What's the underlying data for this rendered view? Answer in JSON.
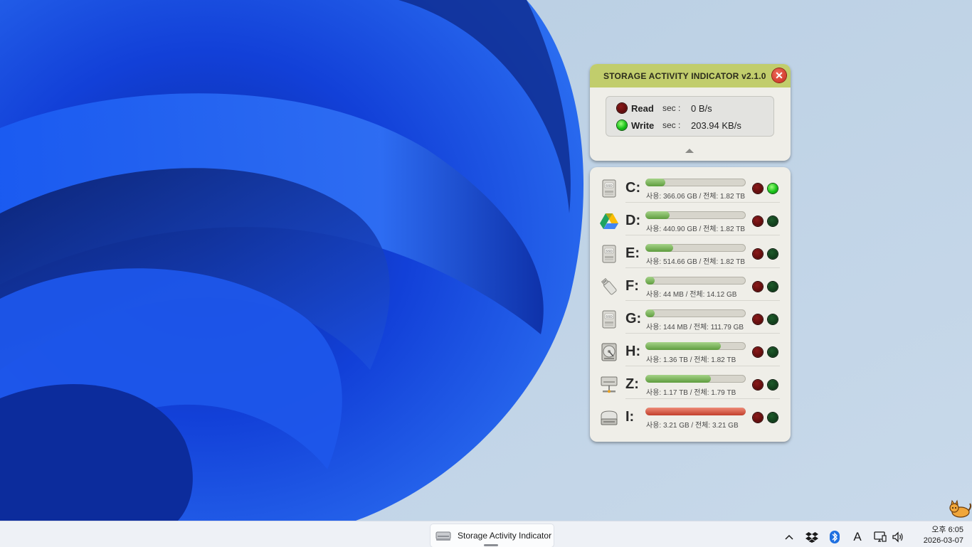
{
  "widget": {
    "title": "STORAGE ACTIVITY INDICATOR  v2.1.0",
    "close_label": "✕",
    "read_label": "Read",
    "write_label": "Write",
    "sec_label": "sec :",
    "read_value": "0 B/s",
    "write_value": "203.94 KB/s",
    "read_led_active": false,
    "write_led_active": true
  },
  "drives": [
    {
      "letter": "C:",
      "icon": "ssd-icon",
      "usage": 0.2,
      "info": "사용: 366.06 GB / 전체: 1.82 TB",
      "read_active": false,
      "write_active": true,
      "full": false
    },
    {
      "letter": "D:",
      "icon": "google-drive-icon",
      "usage": 0.24,
      "info": "사용: 440.90 GB / 전체: 1.82 TB",
      "read_active": false,
      "write_active": false,
      "full": false
    },
    {
      "letter": "E:",
      "icon": "ssd-icon",
      "usage": 0.28,
      "info": "사용: 514.66 GB / 전체: 1.82 TB",
      "read_active": false,
      "write_active": false,
      "full": false
    },
    {
      "letter": "F:",
      "icon": "usb-drive-icon",
      "usage": 0.02,
      "info": "사용: 44 MB / 전체: 14.12 GB",
      "read_active": false,
      "write_active": false,
      "full": false
    },
    {
      "letter": "G:",
      "icon": "ssd-icon",
      "usage": 0.02,
      "info": "사용: 144 MB / 전체: 111.79 GB",
      "read_active": false,
      "write_active": false,
      "full": false
    },
    {
      "letter": "H:",
      "icon": "hard-disk-icon",
      "usage": 0.75,
      "info": "사용: 1.36 TB / 전체: 1.82 TB",
      "read_active": false,
      "write_active": false,
      "full": false
    },
    {
      "letter": "Z:",
      "icon": "network-drive-icon",
      "usage": 0.65,
      "info": "사용: 1.17 TB / 전체: 1.79 TB",
      "read_active": false,
      "write_active": false,
      "full": false
    },
    {
      "letter": "I:",
      "icon": "optical-drive-icon",
      "usage": 1.0,
      "info": "사용: 3.21 GB / 전체: 3.21 GB",
      "read_active": false,
      "write_active": false,
      "full": true
    }
  ],
  "taskbar": {
    "app_label": "Storage Activity Indicator",
    "clock_time": "오후 6:05",
    "clock_date": "2026-03-07",
    "ime_label": "A"
  }
}
